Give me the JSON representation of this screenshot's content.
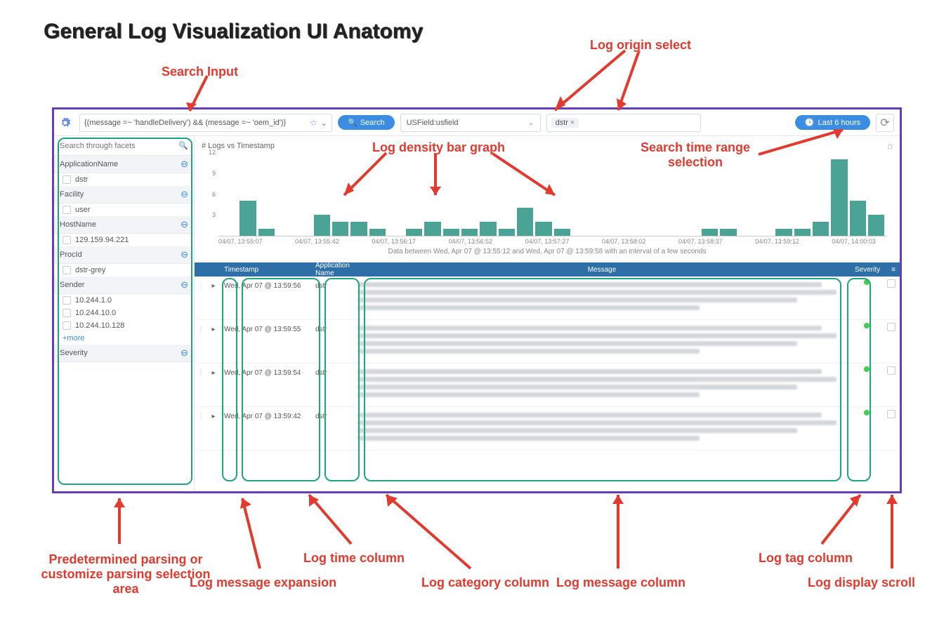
{
  "page_title": "General Log Visualization UI Anatomy",
  "annotations": {
    "search_input": "Search Input",
    "log_origin_select": "Log origin select",
    "log_density": "Log density bar graph",
    "time_range_sel": "Search time range selection",
    "predetermined": "Predetermined parsing or customize parsing selection area",
    "msg_expansion": "Log message expansion",
    "time_column": "Log time column",
    "category_column": "Log category column",
    "msg_column": "Log message column",
    "tag_column": "Log tag column",
    "display_scroll": "Log display scroll"
  },
  "toolbar": {
    "query": "{(message =~ 'handleDelivery') && (message =~ 'oem_id')}",
    "search_label": "Search",
    "origin_selected": "USField:usfield",
    "tag_chip": "dstr",
    "time_range_label": "Last 6 hours"
  },
  "sidebar": {
    "search_placeholder": "Search through facets",
    "more_label": "+more",
    "groups": [
      {
        "name": "ApplicationName",
        "items": [
          "dstr"
        ]
      },
      {
        "name": "Facility",
        "items": [
          "user"
        ]
      },
      {
        "name": "HostName",
        "items": [
          "129.159.94.221"
        ]
      },
      {
        "name": "ProcId",
        "items": [
          "dstr-grey"
        ]
      },
      {
        "name": "Sender",
        "items": [
          "10.244.1.0",
          "10.244.10.0",
          "10.244.10.128"
        ]
      },
      {
        "name": "Severity",
        "items": []
      }
    ]
  },
  "chart": {
    "title": "# Logs vs Timestamp",
    "footer": "Data between  Wed, Apr 07 @ 13:55:12  and Wed, Apr 07 @ 13:59:58 with an interval of a few seconds"
  },
  "chart_data": {
    "type": "bar",
    "ylim": [
      0,
      12
    ],
    "y_ticks": [
      12,
      9,
      6,
      3
    ],
    "x_ticks": [
      "04/07, 13:55:07",
      "04/07, 13:55:42",
      "04/07, 13:56:17",
      "04/07, 13:56:52",
      "04/07, 13:57:27",
      "04/07, 13:58:02",
      "04/07, 13:58:37",
      "04/07, 13:59:12",
      "04/07, 14:00:03"
    ],
    "values": [
      0,
      5,
      1,
      0,
      0,
      3,
      2,
      2,
      1,
      0,
      1,
      2,
      1,
      1,
      2,
      1,
      4,
      2,
      1,
      0,
      0,
      0,
      0,
      0,
      0,
      0,
      1,
      1,
      0,
      0,
      1,
      1,
      2,
      11,
      5,
      3
    ]
  },
  "table": {
    "headers": {
      "timestamp": "Timestamp",
      "app": "Application Name",
      "message": "Message",
      "severity": "Severity"
    },
    "rows": [
      {
        "time": "Wed, Apr 07 @ 13:59:56",
        "app": "dstr"
      },
      {
        "time": "Wed, Apr 07 @ 13:59:55",
        "app": "dstr"
      },
      {
        "time": "Wed, Apr 07 @ 13:59:54",
        "app": "dstr"
      },
      {
        "time": "Wed, Apr 07 @ 13:59:42",
        "app": "dstr"
      }
    ]
  }
}
